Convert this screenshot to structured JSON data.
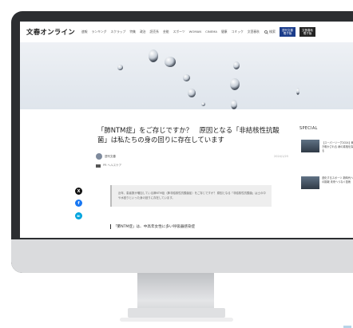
{
  "site": {
    "logo": "文春オンライン",
    "nav": [
      "速報",
      "ランキング",
      "スクラップ",
      "特集",
      "政治",
      "読売系",
      "芸能",
      "スポーツ",
      "WOMAN",
      "CINEMA",
      "健康",
      "コミック",
      "文藝春秋"
    ],
    "search_label": "検索",
    "header_buttons": [
      "週刊文春 電子版",
      "文藝春秋 電子版"
    ]
  },
  "article": {
    "title": "「肺NTM症」をご存じですか？　原因となる「非結核性抗酸菌」は私たちの身の回りに存在しています",
    "author": "週刊文春",
    "date": "2024/1/25",
    "tag": "PR  ヘルスケア",
    "summary": "近年、患者数が増加している肺NTM症（肺非結核性抗酸菌症）をご存じですか？ 原因となる「非結核性抗酸菌」は土の中や水回りといった身の回りに存在しています。",
    "section_heading": "「肺NTM症」は、中高年女性に多い呼吸器感染症"
  },
  "sidebar": {
    "label": "SPECIAL",
    "items": [
      {
        "text": "【スーパーリーグ2024】解き明かされる 病の真相を探る"
      },
      {
        "text": "進化するスポーツ 新時代への挑戦 未来へつなぐ技術"
      }
    ]
  },
  "social": [
    "X",
    "f",
    "B!"
  ],
  "colors": {
    "accent": "#1b3c8a",
    "bezel": "#2c2e31",
    "chin": "#dadbdd"
  }
}
